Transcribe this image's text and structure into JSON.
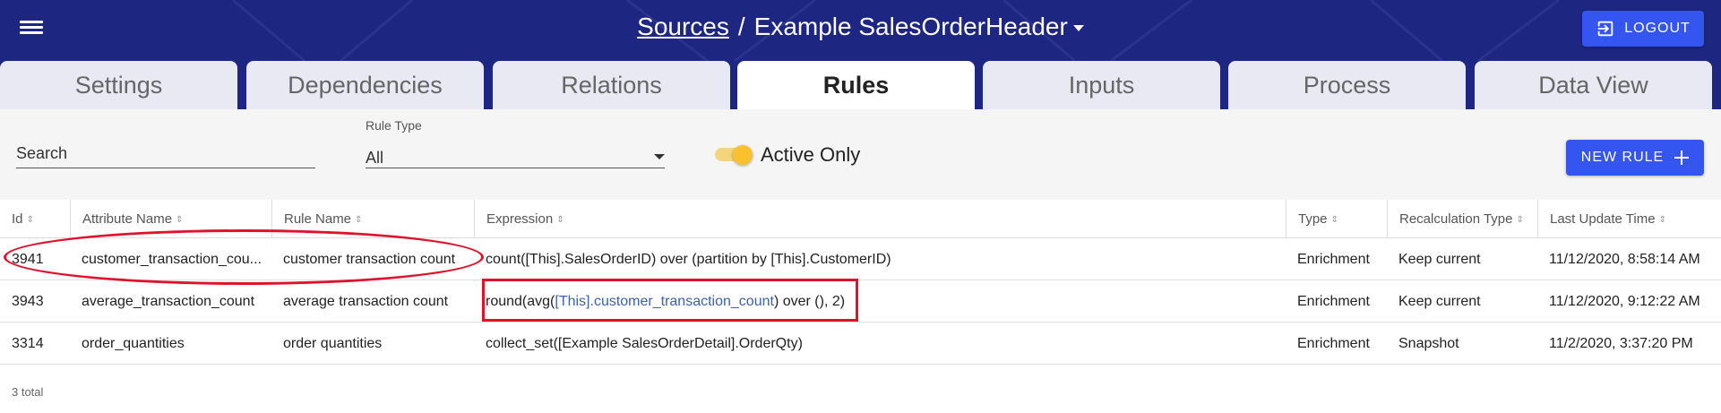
{
  "header": {
    "breadcrumb_link": "Sources",
    "separator": "/",
    "current": "Example SalesOrderHeader",
    "logout_label": "LOGOUT",
    "icons": {
      "menu": "menu-icon",
      "logout": "logout-icon",
      "dropdown": "caret-down-icon"
    }
  },
  "tabs": [
    {
      "label": "Settings",
      "active": false
    },
    {
      "label": "Dependencies",
      "active": false
    },
    {
      "label": "Relations",
      "active": false
    },
    {
      "label": "Rules",
      "active": true
    },
    {
      "label": "Inputs",
      "active": false
    },
    {
      "label": "Process",
      "active": false
    },
    {
      "label": "Data View",
      "active": false
    }
  ],
  "filters": {
    "search_placeholder": "Search",
    "rule_type_label": "Rule Type",
    "rule_type_value": "All",
    "active_only_label": "Active Only",
    "active_only_on": true,
    "new_rule_label": "NEW RULE"
  },
  "table": {
    "columns": [
      "Id",
      "Attribute Name",
      "Rule Name",
      "Expression",
      "Type",
      "Recalculation Type",
      "Last Update Time"
    ],
    "rows": [
      {
        "id": "3941",
        "attribute": "customer_transaction_cou...",
        "rule": "customer transaction count",
        "expr_pre": "count([This].SalesOrderID) over (partition by [This].CustomerID)",
        "expr_link": "",
        "expr_post": "",
        "type": "Enrichment",
        "recalc": "Keep current",
        "updated": "11/12/2020, 8:58:14 AM"
      },
      {
        "id": "3943",
        "attribute": "average_transaction_count",
        "rule": "average transaction count",
        "expr_pre": "round(avg(",
        "expr_link": "[This].customer_transaction_count",
        "expr_post": ") over (), 2)",
        "type": "Enrichment",
        "recalc": "Keep current",
        "updated": "11/12/2020, 9:12:22 AM"
      },
      {
        "id": "3314",
        "attribute": "order_quantities",
        "rule": "order quantities",
        "expr_pre": "collect_set([Example SalesOrderDetail].OrderQty)",
        "expr_link": "",
        "expr_post": "",
        "type": "Enrichment",
        "recalc": "Snapshot",
        "updated": "11/2/2020, 3:37:20 PM"
      }
    ],
    "total_label": "3 total"
  },
  "colors": {
    "header_bg": "#1d2680",
    "accent": "#3455f0",
    "toggle": "#fbc02d",
    "annotation": "#e0112b",
    "link": "#3d62a8"
  }
}
